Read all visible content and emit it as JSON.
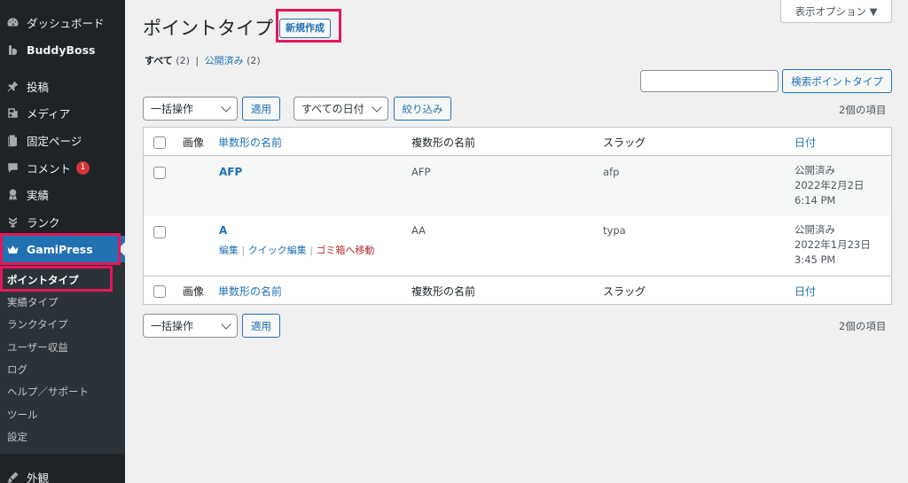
{
  "sidebar": {
    "items": [
      {
        "label": "ダッシュボード",
        "icon": "dashboard-icon"
      },
      {
        "label": "BuddyBoss",
        "icon": "buddyboss-icon"
      },
      {
        "label": "投稿",
        "icon": "pin-icon"
      },
      {
        "label": "メディア",
        "icon": "media-icon"
      },
      {
        "label": "固定ページ",
        "icon": "page-icon"
      },
      {
        "label": "コメント",
        "icon": "comment-icon",
        "badge": "1"
      },
      {
        "label": "実績",
        "icon": "award-icon"
      },
      {
        "label": "ランク",
        "icon": "rank-icon"
      },
      {
        "label": "GamiPress",
        "icon": "crown-icon"
      },
      {
        "label": "外観",
        "icon": "appearance-icon"
      }
    ],
    "submenu": [
      {
        "label": "ポイントタイプ"
      },
      {
        "label": "実績タイプ"
      },
      {
        "label": "ランクタイプ"
      },
      {
        "label": "ユーザー収益"
      },
      {
        "label": "ログ"
      },
      {
        "label": "ヘルプ／サポート"
      },
      {
        "label": "ツール"
      },
      {
        "label": "設定"
      }
    ]
  },
  "header": {
    "title": "ポイントタイプ",
    "add_new": "新規作成",
    "screen_options": "表示オプション ▼"
  },
  "filters": {
    "all_label": "すべて",
    "all_count": "(2)",
    "separator": "|",
    "published_label": "公開済み",
    "published_count": "(2)"
  },
  "search": {
    "button": "検索ポイントタイプ"
  },
  "tablenav": {
    "bulk_action": "一括操作",
    "apply": "適用",
    "date_filter": "すべての日付",
    "filter_button": "絞り込み",
    "item_count": "2個の項目"
  },
  "table": {
    "columns": {
      "image": "画像",
      "singular": "単数形の名前",
      "plural": "複数形の名前",
      "slug": "スラッグ",
      "date": "日付"
    },
    "rows": [
      {
        "singular": "AFP",
        "plural": "AFP",
        "slug": "afp",
        "status": "公開済み",
        "date": "2022年2月2日",
        "time": "6:14 PM"
      },
      {
        "singular": "A",
        "plural": "AA",
        "slug": "typa",
        "status": "公開済み",
        "date": "2022年1月23日",
        "time": "3:45 PM",
        "actions": {
          "edit": "編集",
          "quick_edit": "クイック編集",
          "trash": "ゴミ箱へ移動",
          "sep": "|"
        }
      }
    ]
  },
  "colors": {
    "sidebar_bg": "#1d2327",
    "active": "#2271b1",
    "highlight": "#e4175b",
    "link": "#2271b1",
    "trash": "#b32d2e"
  }
}
